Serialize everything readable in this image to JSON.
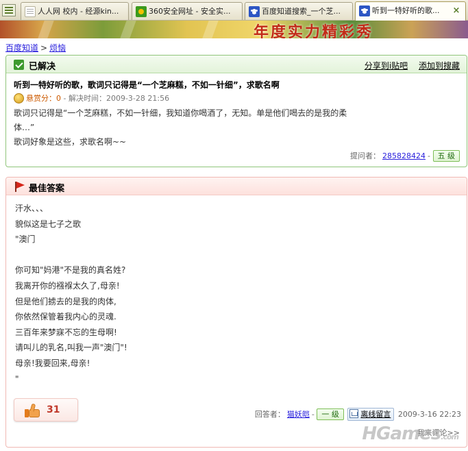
{
  "browser": {
    "tabs": [
      {
        "label": "人人网 校内 - 经源kin...",
        "icon": "page-icon"
      },
      {
        "label": "360安全网址 - 安全实...",
        "icon": "360-icon"
      },
      {
        "label": "百度知道搜索_一个芝...",
        "icon": "paw-icon"
      },
      {
        "label": "听到一特好听的歌...",
        "icon": "paw-icon",
        "active": true
      }
    ],
    "close_label": "×"
  },
  "banner": {
    "text": "年度实力精彩秀"
  },
  "breadcrumb": {
    "home": "百度知道",
    "separator": ">",
    "category": "烦恼"
  },
  "question": {
    "status": "已解决",
    "share_link": "分享到i贴吧",
    "search_link": "添加到搜藏",
    "title": "听到一特好听的歌，歌词只记得是“一个芝麻糕，不如一针细”，求歌名啊",
    "reward_label": "悬赏分：",
    "reward_value": "0",
    "solved_time": " - 解决时间：2009-3-28 21:56",
    "body_lines": [
      "歌词只记得是“一个芝麻糕，不如一针细，我知道你喝酒了，无知。单是他们喝去的是我的柔",
      "体…”",
      "歌词好象是这些，求歌名啊~~"
    ],
    "asker_label": "提问者：",
    "asker_name": "285828424",
    "asker_sep": "-",
    "asker_level": "五 级"
  },
  "answer": {
    "title": "最佳答案",
    "body_lines": [
      "汗水、、、",
      "貌似这是七子之歌",
      "\"澳门",
      "",
      "你可知\"妈港\"不是我的真名姓?",
      "我离开你的襁褓太久了,母亲!",
      "但是他们掳去的是我的肉体,",
      "你依然保管着我内心的灵魂.",
      "三百年来梦寐不忘的生母啊!",
      "请叫儿的乳名,叫我一声\"澳门\"!",
      "母亲!我要回来,母亲!",
      "\""
    ],
    "likes": "31",
    "answerer_label": "回答者：",
    "answerer_name": "猫妖皑",
    "answerer_sep": "-",
    "answerer_level": "一 级",
    "message_label": "离线留言",
    "answer_time": "2009-3-16 22:23",
    "comment_link": "我来评论>>"
  },
  "watermark": {
    "main": "HGames",
    "sub": ".com"
  }
}
